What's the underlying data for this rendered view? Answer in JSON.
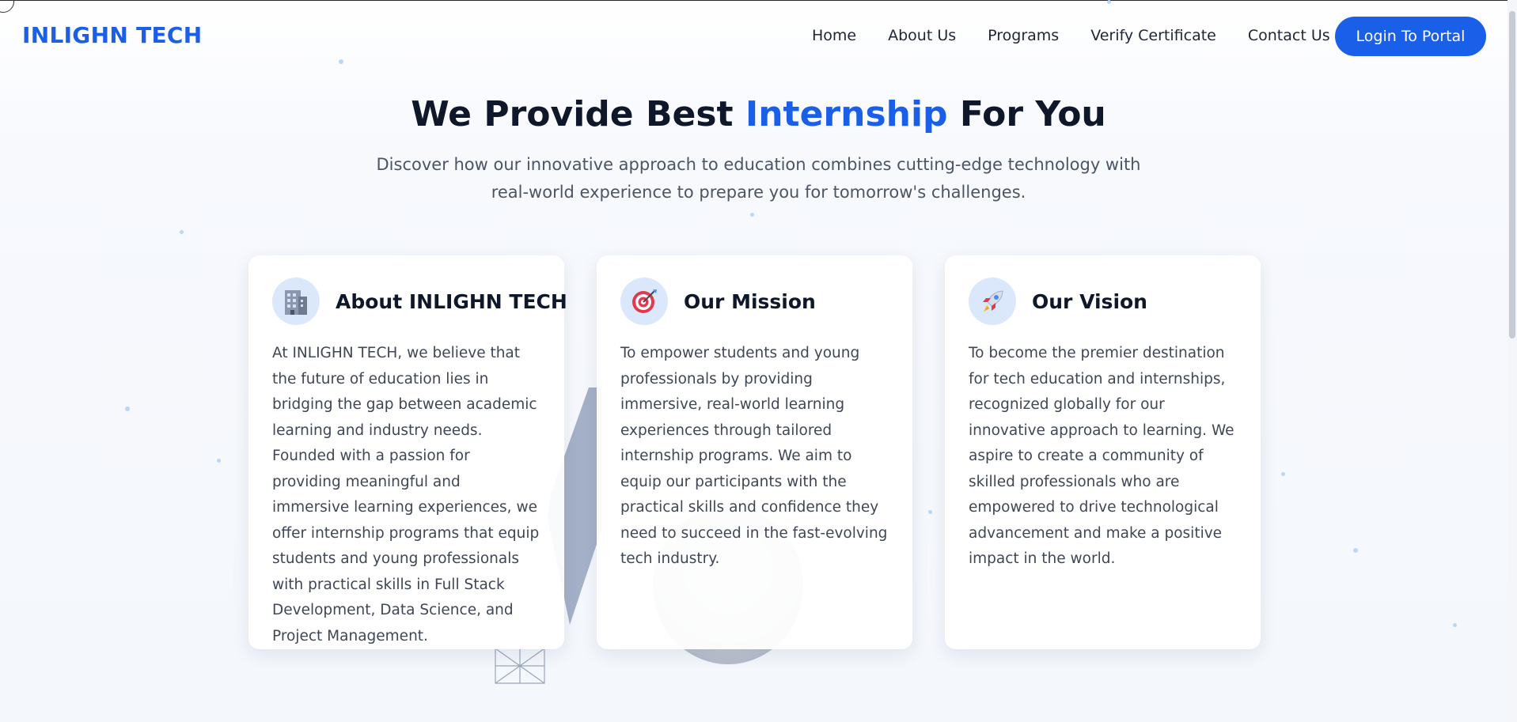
{
  "navbar": {
    "logo": "INLIGHN TECH",
    "links": [
      "Home",
      "About Us",
      "Programs",
      "Verify Certificate",
      "Contact Us"
    ],
    "login_label": "Login To Portal"
  },
  "hero": {
    "title_prefix": "We Provide Best ",
    "title_accent": "Internship",
    "title_suffix": " For You",
    "subtitle": "Discover how our innovative approach to education combines cutting-edge technology with real-world experience to prepare you for tomorrow's challenges."
  },
  "cards": [
    {
      "icon": "office-building-icon",
      "title": "About INLIGHN TECH",
      "body": "At INLIGHN TECH, we believe that the future of education lies in bridging the gap between academic learning and industry needs. Founded with a passion for providing meaningful and immersive learning experiences, we offer internship programs that equip students and young professionals with practical skills in Full Stack Development, Data Science, and Project Management."
    },
    {
      "icon": "target-icon",
      "title": "Our Mission",
      "body": "To empower students and young professionals by providing immersive, real-world learning experiences through tailored internship programs. We aim to equip our participants with the practical skills and confidence they need to succeed in the fast-evolving tech industry."
    },
    {
      "icon": "rocket-icon",
      "title": "Our Vision",
      "body": "To become the premier destination for tech education and internships, recognized globally for our innovative approach to learning. We aspire to create a community of skilled professionals who are empowered to drive technological advancement and make a positive impact in the world."
    }
  ],
  "colors": {
    "accent": "#1a5fe8",
    "heading": "#0f172a",
    "body_text": "#3f4654",
    "icon_bg": "#dbe8fb"
  }
}
